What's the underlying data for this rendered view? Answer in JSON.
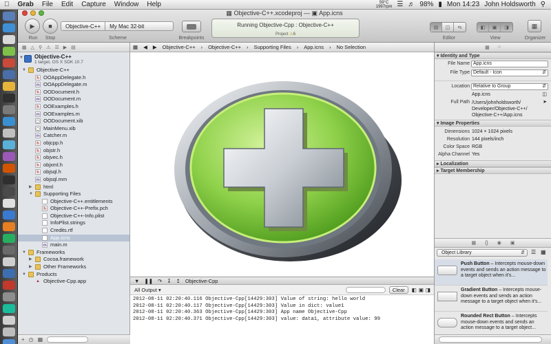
{
  "menubar": {
    "app_name": "Grab",
    "items": [
      "File",
      "Edit",
      "Capture",
      "Window",
      "Help"
    ],
    "status": {
      "temp": "59°C",
      "rpm": "1997rpm",
      "battery": "98%",
      "clock": "Mon 14:23",
      "user": "John Holdsworth"
    }
  },
  "window": {
    "title_project": "Objective-C++.xcodeproj",
    "title_file": "App.icns"
  },
  "toolbar": {
    "run_label": "Run",
    "stop_label": "Stop",
    "scheme_target": "Objective-C++",
    "scheme_destination": "My Mac 32-bit",
    "scheme_label": "Scheme",
    "breakpoints_label": "Breakpoints",
    "activity_status": "Running Objective-Cpp : Objective-C++",
    "activity_sub": "Project",
    "activity_count": "6",
    "editor_label": "Editor",
    "view_label": "View",
    "organizer_label": "Organizer"
  },
  "navigator": {
    "project_name": "Objective-C++",
    "project_sub": "1 target, OS X SDK 10.7",
    "items": [
      {
        "label": "Objective-C++",
        "icon": "folder",
        "depth": 1,
        "open": true
      },
      {
        "label": "OOAppDelegate.h",
        "icon": "h",
        "depth": 2
      },
      {
        "label": "OOAppDelegate.m",
        "icon": "m",
        "depth": 2
      },
      {
        "label": "OODocument.h",
        "icon": "h",
        "depth": 2
      },
      {
        "label": "OODocument.m",
        "icon": "m",
        "depth": 2
      },
      {
        "label": "OOExamples.h",
        "icon": "h",
        "depth": 2
      },
      {
        "label": "OOExamples.m",
        "icon": "m",
        "depth": 2
      },
      {
        "label": "OODocument.xib",
        "icon": "x",
        "depth": 2
      },
      {
        "label": "MainMenu.xib",
        "icon": "x",
        "depth": 2
      },
      {
        "label": "Catcher.m",
        "icon": "m",
        "depth": 2
      },
      {
        "label": "objcpp.h",
        "icon": "h",
        "depth": 2
      },
      {
        "label": "objstr.h",
        "icon": "h",
        "depth": 2
      },
      {
        "label": "objvec.h",
        "icon": "h",
        "depth": 2
      },
      {
        "label": "objxml.h",
        "icon": "h",
        "depth": 2
      },
      {
        "label": "objsql.h",
        "icon": "h",
        "depth": 2
      },
      {
        "label": "objsql.mm",
        "icon": "m",
        "depth": 2
      },
      {
        "label": "html",
        "icon": "folder",
        "depth": 2,
        "open": false
      },
      {
        "label": "Supporting Files",
        "icon": "folder",
        "depth": 2,
        "open": true
      },
      {
        "label": "Objective-C++.entitlements",
        "icon": "g",
        "depth": 3
      },
      {
        "label": "Objective-C++-Prefix.pch",
        "icon": "h",
        "depth": 3
      },
      {
        "label": "Objective-C++-Info.plist",
        "icon": "g",
        "depth": 3
      },
      {
        "label": "InfoPlist.strings",
        "icon": "g",
        "depth": 3
      },
      {
        "label": "Credits.rtf",
        "icon": "g",
        "depth": 3
      },
      {
        "label": "App.icns",
        "icon": "g",
        "depth": 3,
        "selected": true
      },
      {
        "label": "main.m",
        "icon": "m",
        "depth": 3
      },
      {
        "label": "Frameworks",
        "icon": "folder",
        "depth": 1,
        "open": true
      },
      {
        "label": "Cocoa.framework",
        "icon": "folder",
        "depth": 2,
        "open": false
      },
      {
        "label": "Other Frameworks",
        "icon": "folder",
        "depth": 2,
        "open": false
      },
      {
        "label": "Products",
        "icon": "folder",
        "depth": 1,
        "open": true
      },
      {
        "label": "Objective-Cpp.app",
        "icon": "app",
        "depth": 2
      }
    ]
  },
  "jumpbar": {
    "crumbs": [
      "Objective-C++",
      "Objective-C++",
      "Supporting Files",
      "App.icns",
      "No Selection"
    ]
  },
  "debug": {
    "process": "Objective-Cpp",
    "output_filter": "All Output",
    "clear_label": "Clear",
    "console_lines": [
      "2012-08-11 02:20:40.116 Objective-Cpp[14429:303] Value of string: hello world",
      "2012-08-11 02:20:40.117 Objective-Cpp[14429:303] Value in dict: value1",
      "2012-08-11 02:20:40.363 Objective-Cpp[14429:303] App name Objective-Cpp",
      "2012-08-11 02:20:40.371 Objective-Cpp[14429:303] value: data1, attribute value: 99"
    ]
  },
  "inspector": {
    "identity_header": "Identity and Type",
    "file_name_label": "File Name",
    "file_name": "App.icns",
    "file_type_label": "File Type",
    "file_type": "Default - Icon",
    "file_display": "App.icns",
    "location_label": "Location",
    "location": "Relative to Group",
    "full_path_label": "Full Path",
    "full_path_lines": [
      "/Users/johnholdsworth/",
      "Developer/Objective-C++/",
      "Objective-C++/App.icns"
    ],
    "image_header": "Image Properties",
    "dimensions_label": "Dimensions",
    "dimensions": "1024 × 1024 pixels",
    "resolution_label": "Resolution",
    "resolution": "144 pixels/inch",
    "color_space_label": "Color Space",
    "color_space": "RGB",
    "alpha_label": "Alpha Channel",
    "alpha": "Yes",
    "localization_header": "Localization",
    "target_header": "Target Membership",
    "library_select": "Object Library",
    "library": [
      {
        "name": "Push Button",
        "desc": " – Intercepts mouse-down events and sends an action message to a target object when it's..."
      },
      {
        "name": "Gradient Button",
        "desc": " – Intercepts mouse-down events and sends an action message to a target object when it's..."
      },
      {
        "name": "Rounded Rect Button",
        "desc": " – Intercepts mouse-down events and sends an action message to a target object..."
      }
    ]
  }
}
